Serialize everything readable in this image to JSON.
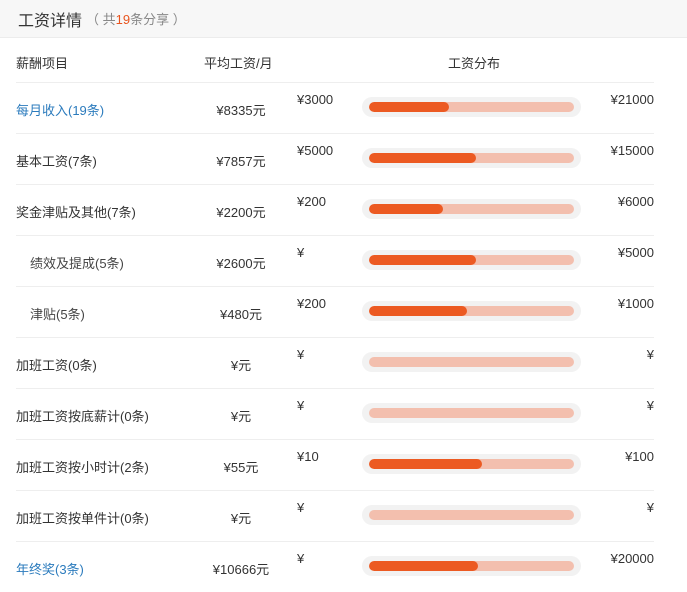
{
  "header": {
    "title": "工资详情",
    "sub_prefix": "（ 共",
    "count": "19",
    "sub_suffix": "条分享 ）"
  },
  "columns": {
    "item": "薪酬项目",
    "avg": "平均工资/月",
    "dist": "工资分布"
  },
  "rows": [
    {
      "name": "每月收入(19条)",
      "avg": "¥8335元",
      "min": "¥3000",
      "max": "¥21000",
      "fill": 0.39
    },
    {
      "name": "基本工资(7条)",
      "avg": "¥7857元",
      "min": "¥5000",
      "max": "¥15000",
      "fill": 0.52
    },
    {
      "name": "奖金津贴及其他(7条)",
      "avg": "¥2200元",
      "min": "¥200",
      "max": "¥6000",
      "fill": 0.36
    },
    {
      "name": "绩效及提成(5条)",
      "avg": "¥2600元",
      "min": "¥",
      "max": "¥5000",
      "fill": 0.52
    },
    {
      "name": "津贴(5条)",
      "avg": "¥480元",
      "min": "¥200",
      "max": "¥1000",
      "fill": 0.48
    },
    {
      "name": "加班工资(0条)",
      "avg": "¥元",
      "min": "¥",
      "max": "¥",
      "fill": 0
    },
    {
      "name": "加班工资按底薪计(0条)",
      "avg": "¥元",
      "min": "¥",
      "max": "¥",
      "fill": 0
    },
    {
      "name": "加班工资按小时计(2条)",
      "avg": "¥55元",
      "min": "¥10",
      "max": "¥100",
      "fill": 0.55
    },
    {
      "name": "加班工资按单件计(0条)",
      "avg": "¥元",
      "min": "¥",
      "max": "¥",
      "fill": 0
    },
    {
      "name": "年终奖(3条)",
      "avg": "¥10666元",
      "min": "¥",
      "max": "¥20000",
      "fill": 0.53
    }
  ],
  "colors": {
    "accent": "#ec5a22",
    "track": "#f3bfae",
    "link": "#2b7bbd"
  }
}
